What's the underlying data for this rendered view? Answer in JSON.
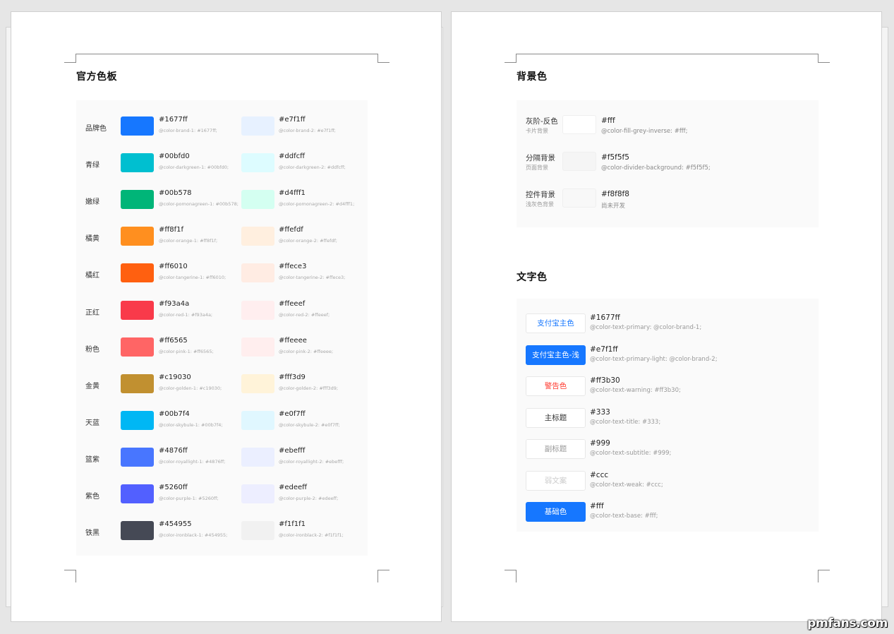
{
  "left_page": {
    "title": "官方色板",
    "palette": [
      {
        "name": "品牌色",
        "primary": {
          "hex": "#1677ff",
          "var": "@color-brand-1: #1677ff;",
          "color": "#1677ff"
        },
        "light": {
          "hex": "#e7f1ff",
          "var": "@color-brand-2: #e7f1ff;",
          "color": "#e7f1ff"
        }
      },
      {
        "name": "青绿",
        "primary": {
          "hex": "#00bfd0",
          "var": "@color-darkgreen-1: #00bfd0;",
          "color": "#00bfd0"
        },
        "light": {
          "hex": "#ddfcff",
          "var": "@color-darkgreen-2: #ddfcff;",
          "color": "#ddfcff"
        }
      },
      {
        "name": "嫩绿",
        "primary": {
          "hex": "#00b578",
          "var": "@color-pomonagreen-1: #00b578;",
          "color": "#00b578"
        },
        "light": {
          "hex": "#d4fff1",
          "var": "@color-pomonagreen-2: #d4fff1;",
          "color": "#d4fff1"
        }
      },
      {
        "name": "橘黄",
        "primary": {
          "hex": "#ff8f1f",
          "var": "@color-orange-1: #ff8f1f;",
          "color": "#ff8f1f"
        },
        "light": {
          "hex": "#ffefdf",
          "var": "@color-orange-2: #ffefdf;",
          "color": "#ffefdf"
        }
      },
      {
        "name": "橘红",
        "primary": {
          "hex": "#ff6010",
          "var": "@color-tangerine-1: #ff6010;",
          "color": "#ff6010"
        },
        "light": {
          "hex": "#ffece3",
          "var": "@color-tangerine-2: #ffece3;",
          "color": "#ffece3"
        }
      },
      {
        "name": "正红",
        "primary": {
          "hex": "#f93a4a",
          "var": "@color-red-1: #f93a4a;",
          "color": "#f93a4a"
        },
        "light": {
          "hex": "#ffeeef",
          "var": "@color-red-2: #ffeeef;",
          "color": "#ffeeef"
        }
      },
      {
        "name": "粉色",
        "primary": {
          "hex": "#ff6565",
          "var": "@color-pink-1: #ff6565;",
          "color": "#ff6565"
        },
        "light": {
          "hex": "#ffeeee",
          "var": "@color-pink-2: #ffeeee;",
          "color": "#ffeeee"
        }
      },
      {
        "name": "金黄",
        "primary": {
          "hex": "#c19030",
          "var": "@color-golden-1: #c19030;",
          "color": "#c19030"
        },
        "light": {
          "hex": "#fff3d9",
          "var": "@color-golden-2: #fff3d9;",
          "color": "#fff3d9"
        }
      },
      {
        "name": "天蓝",
        "primary": {
          "hex": "#00b7f4",
          "var": "@color-skybule-1: #00b7f4;",
          "color": "#00b7f4"
        },
        "light": {
          "hex": "#e0f7ff",
          "var": "@color-skybule-2: #e0f7ff;",
          "color": "#e0f7ff"
        }
      },
      {
        "name": "篮紫",
        "primary": {
          "hex": "#4876ff",
          "var": "@color-royallight-1: #4876ff;",
          "color": "#4876ff"
        },
        "light": {
          "hex": "#ebefff",
          "var": "@color-royallight-2: #ebefff;",
          "color": "#ebefff"
        }
      },
      {
        "name": "紫色",
        "primary": {
          "hex": "#5260ff",
          "var": "@color-purple-1: #5260ff;",
          "color": "#5260ff"
        },
        "light": {
          "hex": "#edeeff",
          "var": "@color-purple-2: #edeeff;",
          "color": "#edeeff"
        }
      },
      {
        "name": "铁黑",
        "primary": {
          "hex": "#454955",
          "var": "@color-ironblack-1: #454955;",
          "color": "#454955"
        },
        "light": {
          "hex": "#f1f1f1",
          "var": "@color-ironblack-2: #f1f1f1;",
          "color": "#f1f1f1"
        }
      }
    ]
  },
  "right_page": {
    "background_title": "背景色",
    "backgrounds": [
      {
        "name": "灰阶-反色",
        "sub": "卡片背景",
        "hex": "#fff",
        "var": "@color-fill-grey-inverse: #fff;",
        "color": "#ffffff"
      },
      {
        "name": "分隔背景",
        "sub": "页面背景",
        "hex": "#f5f5f5",
        "var": "@color-divider-background: #f5f5f5;",
        "color": "#f5f5f5"
      },
      {
        "name": "控件背景",
        "sub": "浅灰色背景",
        "hex": "#f8f8f8",
        "var": "尚未开发",
        "color": "#f8f8f8"
      }
    ],
    "text_title": "文字色",
    "texts": [
      {
        "label": "支付宝主色",
        "hex": "#1677ff",
        "var": "@color-text-primary: @color-brand-1;",
        "fg": "#1677ff",
        "bg": "#ffffff"
      },
      {
        "label": "支付宝主色-浅",
        "hex": "#e7f1ff",
        "var": "@color-text-primary-light: @color-brand-2;",
        "fg": "#ffffff",
        "bg": "#1677ff"
      },
      {
        "label": "警告色",
        "hex": "#ff3b30",
        "var": "@color-text-warning: #ff3b30;",
        "fg": "#ff3b30",
        "bg": "#ffffff"
      },
      {
        "label": "主标题",
        "hex": "#333",
        "var": "@color-text-title: #333;",
        "fg": "#333333",
        "bg": "#ffffff"
      },
      {
        "label": "副标题",
        "hex": "#999",
        "var": "@color-text-subtitle: #999;",
        "fg": "#999999",
        "bg": "#ffffff"
      },
      {
        "label": "弱文案",
        "hex": "#ccc",
        "var": "@color-text-weak: #ccc;",
        "fg": "#cccccc",
        "bg": "#ffffff"
      },
      {
        "label": "基础色",
        "hex": "#fff",
        "var": "@color-text-base: #fff;",
        "fg": "#ffffff",
        "bg": "#1677ff"
      }
    ]
  },
  "watermark": "pmfans.com"
}
